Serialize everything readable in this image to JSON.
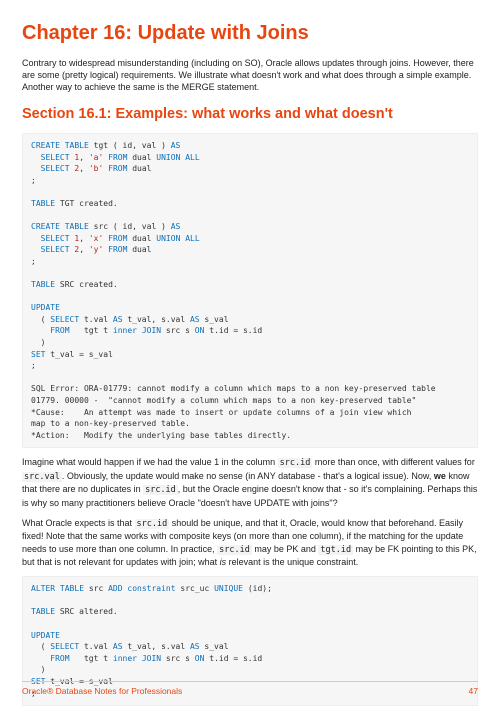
{
  "chapter_title": "Chapter 16: Update with Joins",
  "intro": "Contrary to widespread misunderstanding (including on SO), Oracle allows updates through joins. However, there are some (pretty logical) requirements. We illustrate what doesn't work and what does through a simple example. Another way to achieve the same is the MERGE statement.",
  "section_title": "Section 16.1: Examples: what works and what doesn't",
  "para2_a": "Imagine what would happen if we had the value 1 in the column ",
  "para2_b": " more than once, with different values for ",
  "para2_c": ". Obviously, the update would make no sense (in ANY database - that's a logical issue). Now, ",
  "para2_bold": "we",
  "para2_d": " know that there are no duplicates in ",
  "para2_e": ", but the Oracle engine doesn't know that - so it's complaining. Perhaps this is why so many practitioners believe Oracle \"doesn't have UPDATE with joins\"?",
  "para3_a": "What Oracle expects is that ",
  "para3_b": " should be unique, and that it, Oracle, would know that beforehand. Easily fixed! Note that the same works with composite keys (on more than one column), if the matching for the update needs to use more than one column. In practice, ",
  "para3_c": " may be PK and ",
  "para3_d": " may be FK pointing to this PK, but that is not relevant for updates with join; what ",
  "para3_ital": "is",
  "para3_e": " relevant is the unique constraint.",
  "code_src_id": "src.id",
  "code_src_val": "src.val",
  "code_tgt_id": "tgt.id",
  "footer_title": "Oracle® Database Notes for Professionals",
  "page_number": "47"
}
